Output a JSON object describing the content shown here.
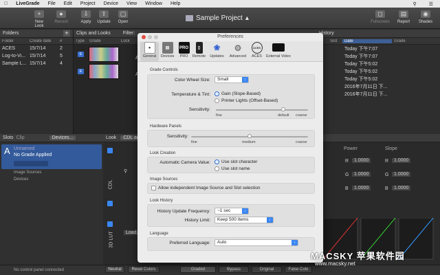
{
  "menubar": {
    "app": "LiveGrade",
    "items": [
      "File",
      "Edit",
      "Project",
      "Device",
      "View",
      "Window",
      "Help"
    ]
  },
  "toolbar": {
    "new_look": "New Look",
    "record": "Record",
    "apply": "Apply",
    "update": "Update",
    "open": "Open",
    "fullscreen": "Fullscreen",
    "report": "Report",
    "shades": "Shades"
  },
  "project": {
    "title": "Sample Project"
  },
  "folders": {
    "title": "Folders",
    "columns": [
      "Folder",
      "Create date",
      "#"
    ],
    "rows": [
      [
        "ACES",
        "15/7/14",
        "2"
      ],
      [
        "Log-to-Vi...",
        "15/7/14",
        "5"
      ],
      [
        "Sample L...",
        "15/7/14",
        "4"
      ]
    ]
  },
  "clips": {
    "title": "Clips and Looks",
    "filter": "Filter:",
    "columns": [
      "Type",
      "Grade",
      "Lock"
    ],
    "badges": [
      "E",
      "E"
    ],
    "row_labels": [
      "AC",
      "AR"
    ]
  },
  "history": {
    "title": "History",
    "columns": [
      "Slot",
      "Date",
      "Grade"
    ],
    "rows": [
      "Today 下午7:07",
      "Today 下午7:07",
      "Today 下午5:02",
      "Today 下午5:02",
      "Today 下午5:02",
      "2016年7月11日 下...",
      "2016年7月11日 下..."
    ]
  },
  "slots": {
    "tab_slots": "Slots",
    "tab_clip": "Clip",
    "devices_btn": "Devices...",
    "slot_letter": "A",
    "slot_name": "Unnamed",
    "slot_grade": "No Grade Applied",
    "image_sources": "Image Sources",
    "devices": "Devices",
    "no_panel": "No control panel connected"
  },
  "look": {
    "title": "Look",
    "mode": "CDL and",
    "cdl_label": "CDL",
    "lut_label": "3D LUT",
    "load": "Load...",
    "power": "Power",
    "slope": "Slope",
    "r": "R",
    "g": "G",
    "b": "B",
    "val": "1.0000"
  },
  "bottom": {
    "neutral": "Neutral",
    "reset": "Reset Colors",
    "graded": "Graded",
    "bypass": "Bypass",
    "original": "Original",
    "false_color": "False Colo"
  },
  "prefs": {
    "title": "Preferences",
    "tabs": [
      "General",
      "Devices",
      "PRO",
      "Remote",
      "Updates",
      "Advanced",
      "ACES",
      "External Video"
    ],
    "grade_controls": {
      "title": "Grade Controls",
      "wheel_label": "Color Wheel Size:",
      "wheel_value": "Small",
      "tt_label": "Temperature & Tint:",
      "tt_opt1": "Gain (Slope-Based)",
      "tt_opt2": "Printer Lights (Offset-Based)",
      "sens_label": "Sensitivity:",
      "fine": "fine",
      "default": "default",
      "coarse": "coarse",
      "sensitivity": 0.73
    },
    "hardware": {
      "title": "Hardware Panels",
      "sens_label": "Sensitivity:",
      "fine": "fine",
      "medium": "medium",
      "coarse": "coarse",
      "sensitivity": 0.5
    },
    "look_creation": {
      "title": "Look Creation",
      "label": "Automatic Camera Value:",
      "opt1": "Use slot character",
      "opt2": "Use slot name"
    },
    "image_sources": {
      "title": "Image Sources",
      "check": "Allow independent Image Source and Slot selection"
    },
    "look_history": {
      "title": "Look History",
      "freq_label": "History Update Frequency:",
      "freq_value": "~1 sec",
      "limit_label": "History Limit:",
      "limit_value": "Keep 500 Items"
    },
    "language": {
      "title": "Language",
      "label": "Preferred Language:",
      "value": "Auto"
    }
  },
  "watermark": {
    "line1": "MACSKY 苹果软件园",
    "line2": "www.macsky.net"
  },
  "colors": {
    "accent": "#3b87f2",
    "slot_card": "#335a9a"
  }
}
